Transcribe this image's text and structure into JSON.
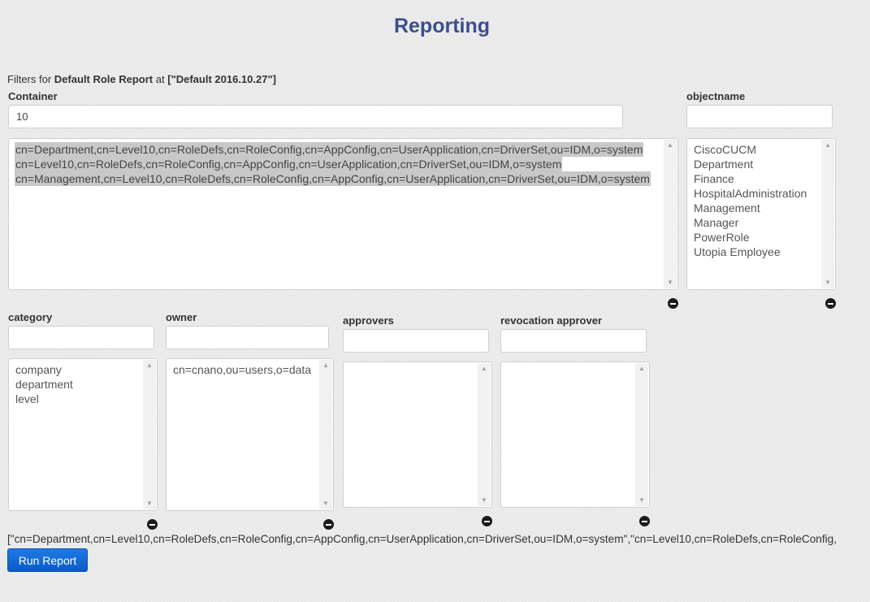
{
  "page": {
    "title": "Reporting",
    "filters_prefix": "Filters for",
    "report_name": "Default Role Report",
    "at_text": "at",
    "report_instance": "[\"Default 2016.10.27\"]"
  },
  "container": {
    "label": "Container",
    "value": "10",
    "options": [
      "cn=Department,cn=Level10,cn=RoleDefs,cn=RoleConfig,cn=AppConfig,cn=UserApplication,cn=DriverSet,ou=IDM,o=system",
      "cn=Level10,cn=RoleDefs,cn=RoleConfig,cn=AppConfig,cn=UserApplication,cn=DriverSet,ou=IDM,o=system",
      "cn=Management,cn=Level10,cn=RoleDefs,cn=RoleConfig,cn=AppConfig,cn=UserApplication,cn=DriverSet,ou=IDM,o=system"
    ]
  },
  "objectname": {
    "label": "objectname",
    "value": "",
    "options": [
      "CiscoCUCM",
      "Department",
      "Finance",
      "HospitalAdministration",
      "Management",
      "Manager",
      "PowerRole",
      "Utopia Employee"
    ]
  },
  "category": {
    "label": "category",
    "value": "",
    "options": [
      "company",
      "department",
      "level"
    ]
  },
  "owner": {
    "label": "owner",
    "value": "",
    "options": [
      "cn=cnano,ou=users,o=data"
    ]
  },
  "approvers": {
    "label": "approvers",
    "value": "",
    "options": []
  },
  "revocation_approver": {
    "label": "revocation approver",
    "value": "",
    "options": []
  },
  "selection_summary": "[\"cn=Department,cn=Level10,cn=RoleDefs,cn=RoleConfig,cn=AppConfig,cn=UserApplication,cn=DriverSet,ou=IDM,o=system\",\"cn=Level10,cn=RoleDefs,cn=RoleConfig,",
  "run_button_label": "Run Report",
  "icons": {
    "scroll_up": "▲",
    "scroll_down": "▼",
    "remove": "minus-circle-icon"
  }
}
